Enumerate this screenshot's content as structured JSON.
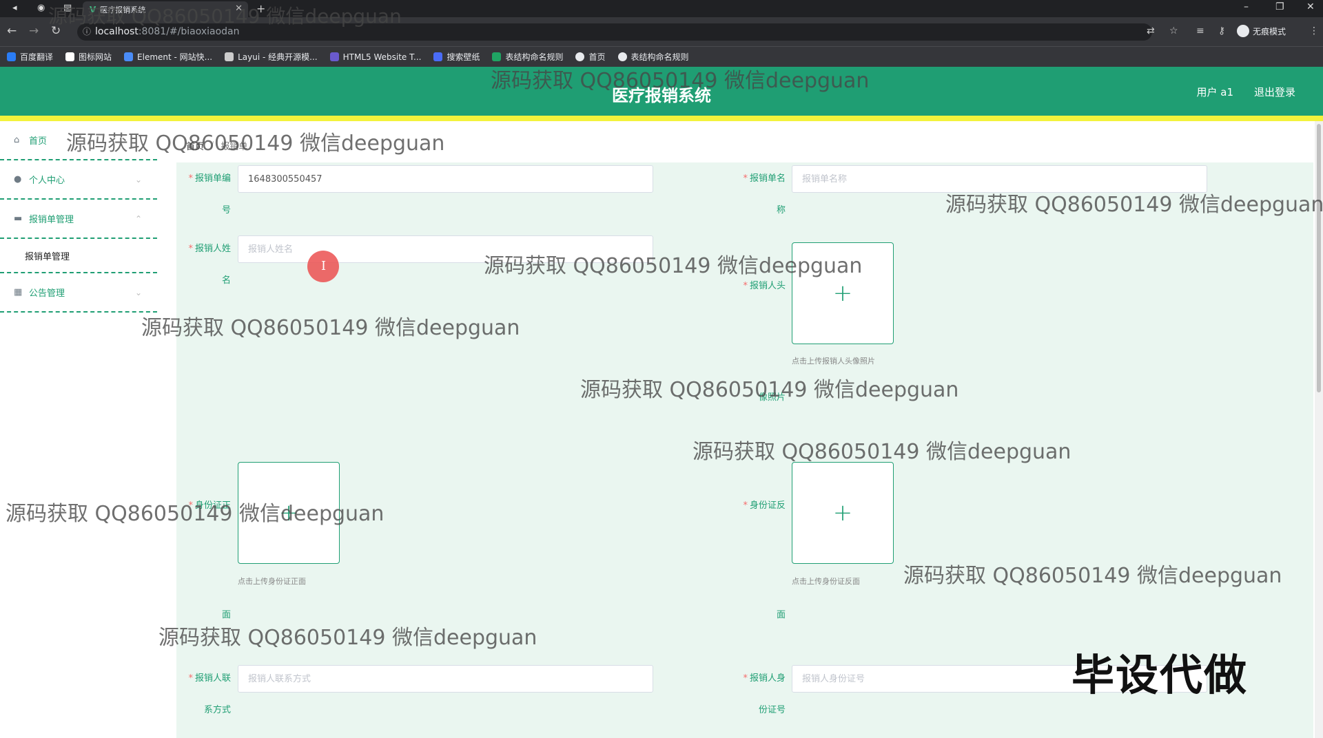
{
  "browser": {
    "tab_title": "医疗报销系统",
    "url_host": "localhost",
    "url_path": ":8081/#/biaoxiaodan",
    "incognito_label": "无痕模式",
    "bookmarks": [
      {
        "label": "百度翻译",
        "color": "#2a7cf5"
      },
      {
        "label": "图标网站",
        "color": "#ffffff"
      },
      {
        "label": "Element - 网站快...",
        "color": "#4a8cf7"
      },
      {
        "label": "Layui - 经典开源模...",
        "color": "#cccccc"
      },
      {
        "label": "HTML5 Website T...",
        "color": "#6a5acd"
      },
      {
        "label": "搜索壁纸",
        "color": "#4a6cf7"
      },
      {
        "label": "表结构命名规则",
        "color": "#1fa463"
      },
      {
        "label": "首页",
        "color": "#e8eaed"
      },
      {
        "label": "表结构命名规则",
        "color": "#e8eaed"
      }
    ]
  },
  "header": {
    "title": "医疗报销系统",
    "user": "用户 a1",
    "logout": "退出登录",
    "brand_color": "#1f9e73",
    "accent_color": "#f3f23c"
  },
  "sidebar": {
    "items": [
      {
        "label": "首页",
        "icon": "home-icon"
      },
      {
        "label": "个人中心",
        "icon": "user-icon"
      },
      {
        "label": "报销单管理",
        "icon": "briefcase-icon"
      },
      {
        "label": "报销单管理"
      },
      {
        "label": "公告管理",
        "icon": "grid-icon"
      }
    ]
  },
  "breadcrumb": {
    "home": "首页",
    "sep": "/",
    "current": "报销单"
  },
  "form": {
    "bill_no": {
      "label1": "报销单编",
      "label2": "号",
      "value": "1648300550457"
    },
    "bill_name": {
      "label1": "报销单名",
      "label2": "称",
      "placeholder": "报销单名称"
    },
    "person_name": {
      "label1": "报销人姓",
      "label2": "名",
      "placeholder": "报销人姓名"
    },
    "avatar": {
      "label1": "报销人头",
      "label2": "像照片",
      "tip": "点击上传报销人头像照片"
    },
    "id_front": {
      "label1": "身份证正",
      "label2": "面",
      "tip": "点击上传身份证正面"
    },
    "id_back": {
      "label1": "身份证反",
      "label2": "面",
      "tip": "点击上传身份证反面"
    },
    "contact": {
      "label1": "报销人联",
      "label2": "系方式",
      "placeholder": "报销人联系方式"
    },
    "id_no": {
      "label1": "报销人身",
      "label2": "份证号",
      "placeholder": "报销人身份证号"
    }
  },
  "watermark": "源码获取 QQ86050149 微信deepguan",
  "stamp": "毕设代做"
}
